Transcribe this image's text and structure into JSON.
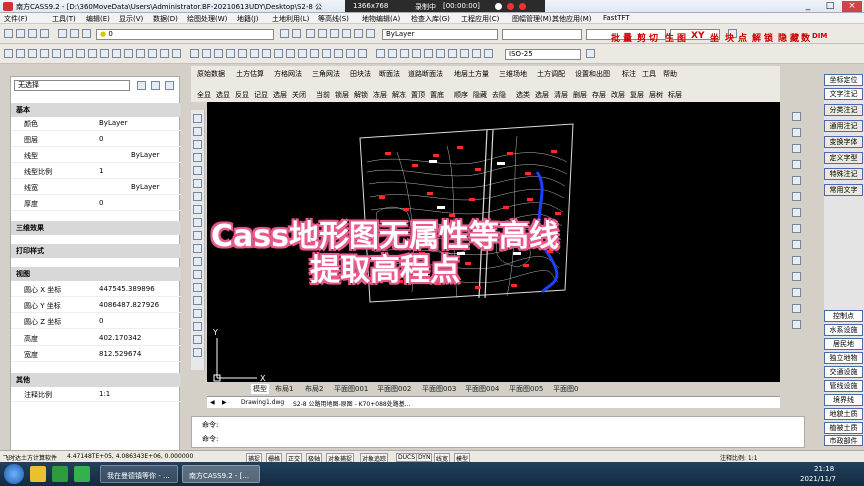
{
  "title": "南方CASS9.2 - [D:\\360MoveData\\Users\\Administrator.BF-20210613UDY\\Desktop\\S2-8 公",
  "recorder": {
    "resolution": "1366x768",
    "status": "录制中",
    "time": "[00:00:00]"
  },
  "menu": [
    "文件(F)",
    "工具(T)",
    "编辑(E)",
    "显示(V)",
    "数据(D)",
    "绘图处理(W)",
    "地籍(J)",
    "土地利用(L)",
    "等高线(S)",
    "地物编辑(A)",
    "检查入库(G)",
    "工程应用(C)",
    "图幅管理(M)",
    "其他应用(M)",
    "FastTFT"
  ],
  "toolbar": {
    "layer_value": "0",
    "color_value": "ByLayer",
    "dimstyle_value": "ISO-25",
    "red_buttons": [
      "批",
      "量",
      "剪",
      "切",
      "生",
      "图",
      "XY",
      "坐",
      "块",
      "点",
      "解",
      "锁",
      "隐",
      "藏",
      "数",
      "DIM"
    ]
  },
  "properties": {
    "selection": "无选择",
    "sections": {
      "basic": "基本",
      "three_d": "三维效果",
      "print": "打印样式",
      "view": "视图",
      "misc": "其他"
    },
    "basic": [
      {
        "label": "颜色",
        "value": "ByLayer"
      },
      {
        "label": "图层",
        "value": "0"
      },
      {
        "label": "线型",
        "value": "ByLayer"
      },
      {
        "label": "线型比例",
        "value": "1"
      },
      {
        "label": "线宽",
        "value": "ByLayer"
      },
      {
        "label": "厚度",
        "value": "0"
      }
    ],
    "view": [
      {
        "label": "圆心 X 坐标",
        "value": "447545.389896"
      },
      {
        "label": "圆心 Y 坐标",
        "value": "4086487.827926"
      },
      {
        "label": "圆心 Z 坐标",
        "value": "0"
      },
      {
        "label": "高度",
        "value": "402.170342"
      },
      {
        "label": "宽度",
        "value": "812.529674"
      }
    ],
    "misc": [
      {
        "label": "注释比例",
        "value": "1:1"
      }
    ]
  },
  "cass_tabs": [
    "原始数据",
    "土方估算",
    "方格网法",
    "三角网法",
    "田块法",
    "断面法",
    "道路断面法",
    "地层土方量",
    "三维场地",
    "土方调配",
    "设置和出图",
    "标注",
    "工具",
    "帮助"
  ],
  "cass_tools": [
    "全显",
    "选显",
    "反显",
    "记显",
    "选层",
    "关闭",
    "当前",
    "锁层",
    "解锁",
    "冻层",
    "解冻",
    "置顶",
    "置底",
    "顺序",
    "隐藏",
    "去隐",
    "选类",
    "选层",
    "清层",
    "删层",
    "存层",
    "改层",
    "复层",
    "层树",
    "标层"
  ],
  "layout_tabs": [
    "模型",
    "布局1",
    "布局2",
    "平面图001",
    "平面图002",
    "平面图003",
    "平面图004",
    "平面图005",
    "平面图0"
  ],
  "doc_tabs": [
    "Drawing1.dwg",
    "S2-8 公路用地图-原图 - K70+088处路基..."
  ],
  "command": {
    "prompt": "命令:"
  },
  "right_panel": {
    "top": [
      "坐标定位",
      "文字注记",
      "分类注记",
      "通用注记",
      "变换字体",
      "定义字型",
      "特殊注记",
      "常用文字"
    ],
    "bottom": [
      "控制点",
      "水系设施",
      "居民地",
      "独立地物",
      "交通设施",
      "管线设施",
      "境界线",
      "地貌土质",
      "植被土质",
      "市政部件"
    ]
  },
  "status": {
    "app": "飞时达土方计算软件",
    "coords": "4.47148TE+05, 4.086343E+06, 0.000000",
    "toggles": [
      "捕捉",
      "栅格",
      "正交",
      "极轴",
      "对象捕捉",
      "对象追踪",
      "DUCS",
      "DYN",
      "线宽",
      "模型"
    ],
    "scale": "注释比例: 1:1"
  },
  "taskbar": {
    "item1": "我在曼德镇等你 - ...",
    "item2": "南方CASS9.2 - [...",
    "time": "21:18",
    "date": "2021/11/7"
  },
  "overlay": {
    "line1": "Cass地形图无属性等高线",
    "line2": "提取高程点"
  }
}
